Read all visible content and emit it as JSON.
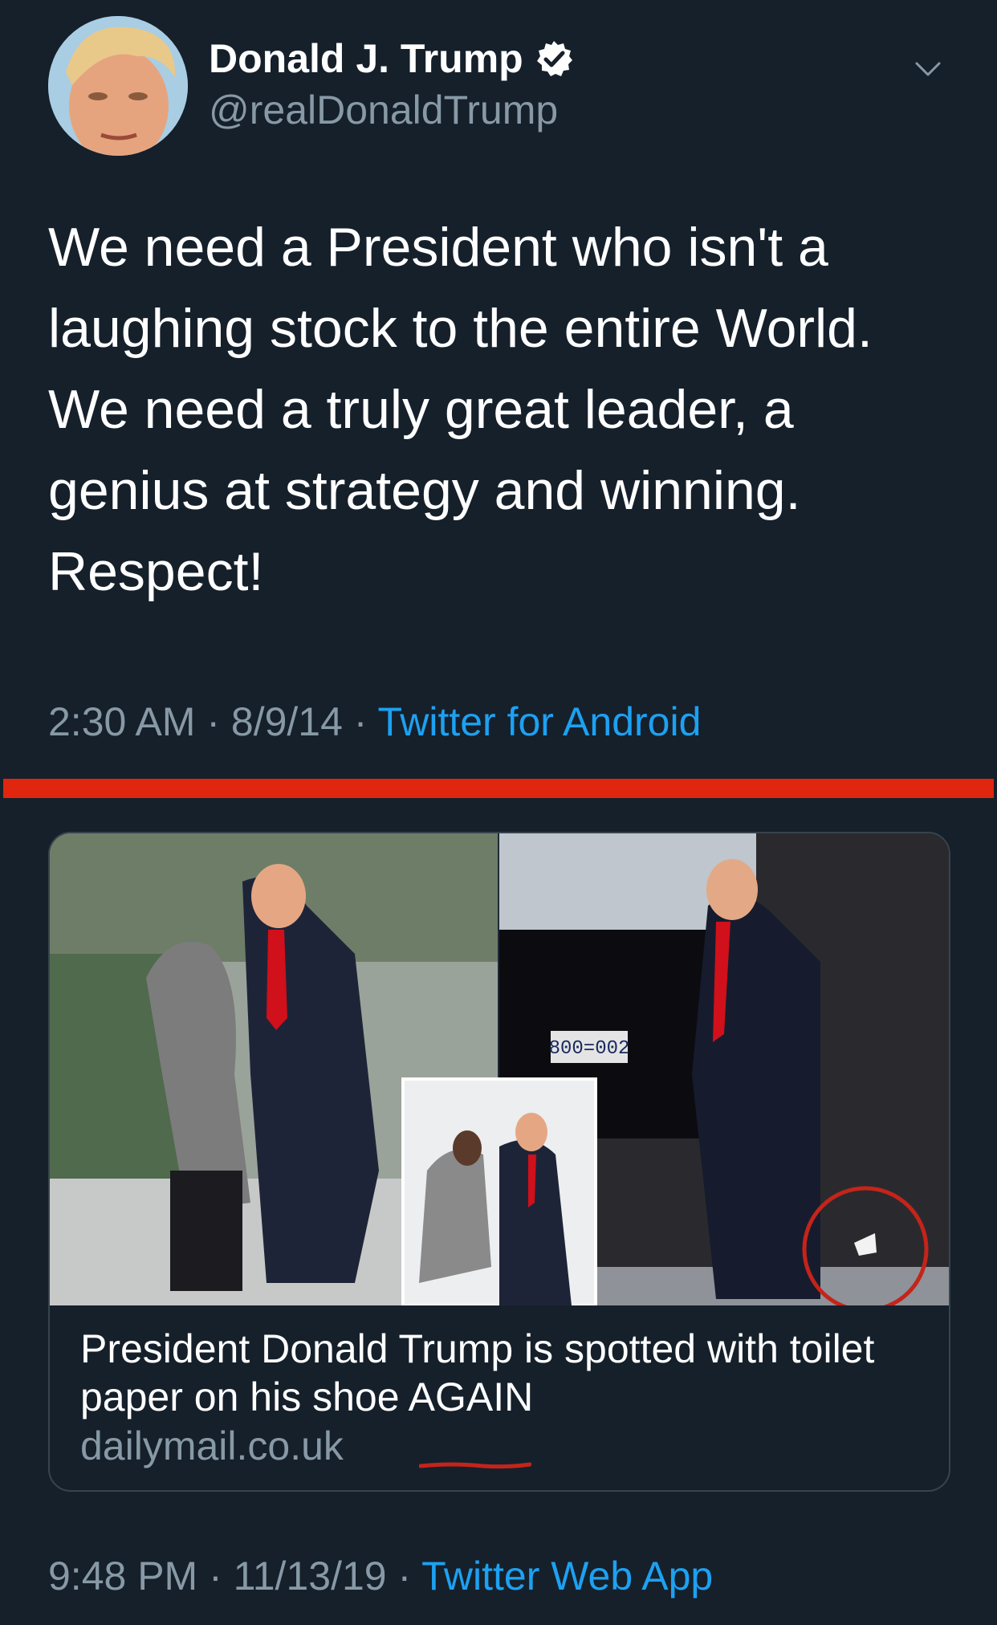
{
  "author": {
    "name": "Donald J. Trump",
    "handle": "@realDonaldTrump",
    "verified": true
  },
  "tweet": {
    "text": "We need a President who isn't a laughing stock to the entire World. We need a truly great leader, a genius at strategy and winning. Respect!",
    "time": "2:30 AM",
    "date": "8/9/14",
    "source": "Twitter for Android"
  },
  "separator": {
    "color": "#e0260f"
  },
  "link_card": {
    "title": "President Donald Trump is spotted with toilet paper on his shoe AGAIN",
    "domain": "dailymail.co.uk",
    "plate_text": "800=002"
  },
  "second_meta": {
    "time": "9:48 PM",
    "date": "11/13/19",
    "source": "Twitter Web App"
  },
  "colors": {
    "background": "#15202b",
    "secondary_text": "#8899a6",
    "link": "#1da1f2",
    "verified_badge": "#ffffff"
  },
  "icons": [
    "verified-badge-icon",
    "chevron-down-icon"
  ]
}
